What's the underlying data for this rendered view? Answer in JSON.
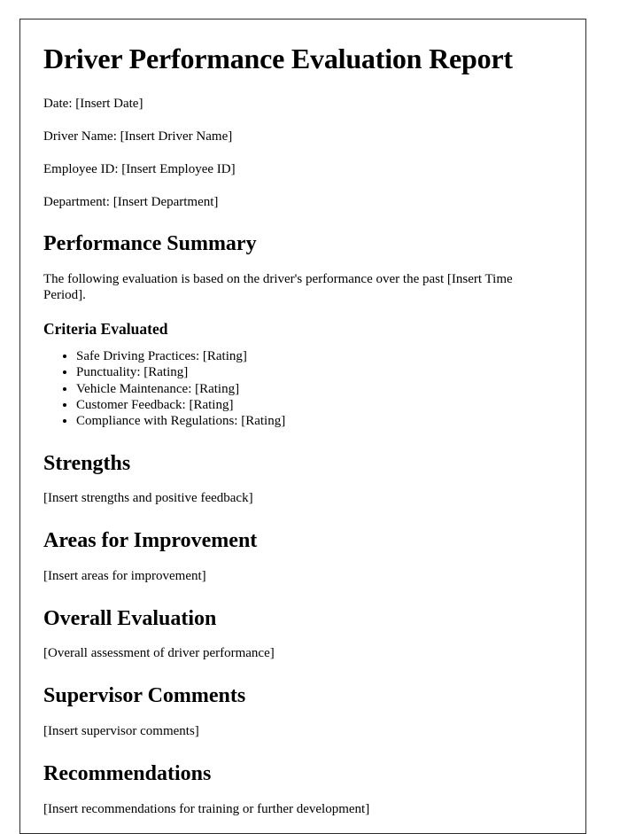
{
  "document": {
    "title": "Driver Performance Evaluation Report",
    "meta_fields": [
      "Date: [Insert Date]",
      "Driver Name: [Insert Driver Name]",
      "Employee ID: [Insert Employee ID]",
      "Department: [Insert Department]"
    ],
    "performance_summary": {
      "heading": "Performance Summary",
      "intro": "The following evaluation is based on the driver's performance over the past [Insert Time Period].",
      "criteria": {
        "heading": "Criteria Evaluated",
        "items": [
          "Safe Driving Practices: [Rating]",
          "Punctuality: [Rating]",
          "Vehicle Maintenance: [Rating]",
          "Customer Feedback: [Rating]",
          "Compliance with Regulations: [Rating]"
        ]
      }
    },
    "sections": [
      {
        "heading": "Strengths",
        "body": "[Insert strengths and positive feedback]"
      },
      {
        "heading": "Areas for Improvement",
        "body": "[Insert areas for improvement]"
      },
      {
        "heading": "Overall Evaluation",
        "body": "[Overall assessment of driver performance]"
      },
      {
        "heading": "Supervisor Comments",
        "body": "[Insert supervisor comments]"
      },
      {
        "heading": "Recommendations",
        "body": "[Insert recommendations for training or further development]"
      }
    ]
  }
}
